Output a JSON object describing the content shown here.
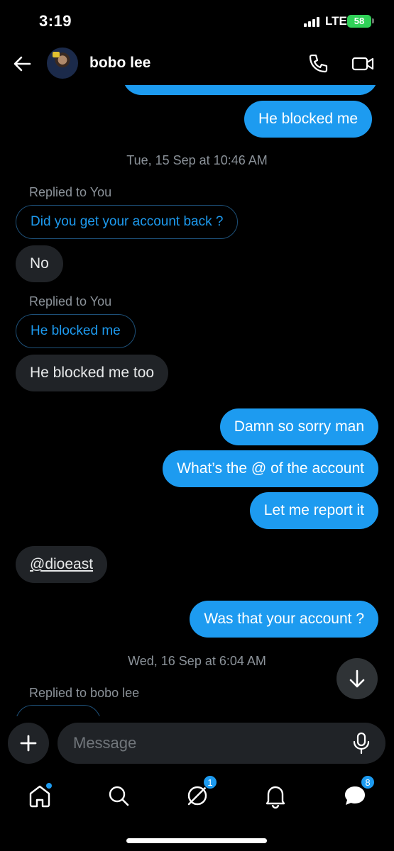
{
  "status": {
    "time": "3:19",
    "network": "LTE",
    "battery": "58"
  },
  "header": {
    "contact_name": "bobo lee"
  },
  "messages": {
    "m1": "He blocked me",
    "date1": "Tue, 15 Sep at 10:46 AM",
    "reply_meta1": "Replied to You",
    "quote1": "Did you get your account back ?",
    "m2": "No",
    "reply_meta2": "Replied to You",
    "quote2": "He blocked me",
    "m3": "He blocked me too",
    "m4": "Damn so sorry man",
    "m5": "What’s the @ of the account",
    "m6": "Let me report it",
    "m7": "@dioeast",
    "m8": "Was that your account ?",
    "date2": "Wed, 16 Sep at 6:04 AM",
    "reply_meta3": "Replied to bobo lee"
  },
  "composer": {
    "placeholder": "Message"
  },
  "tabbar": {
    "icons": [
      "home-icon",
      "search-icon",
      "grok-icon",
      "bell-icon",
      "messages-icon"
    ],
    "grok_badge": "1",
    "messages_badge": "8"
  },
  "colors": {
    "accent": "#1d9bf0",
    "received_bubble": "#202327",
    "background": "#000000"
  }
}
